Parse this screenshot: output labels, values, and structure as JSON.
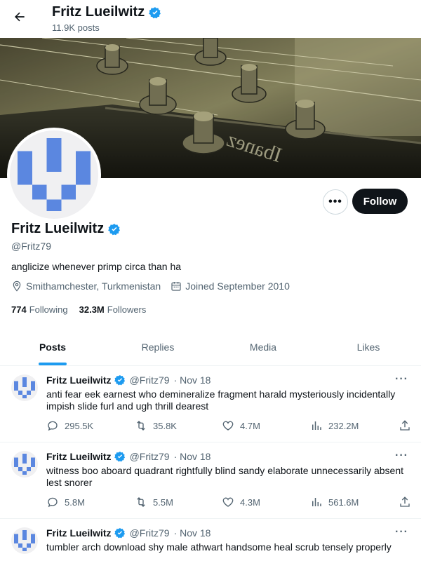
{
  "header": {
    "name": "Fritz Lueilwitz",
    "posts_count": "11.9K posts"
  },
  "profile": {
    "name": "Fritz Lueilwitz",
    "handle": "@Fritz79",
    "bio": "anglicize whenever primp circa than ha",
    "location": "Smithamchester, Turkmenistan",
    "joined": "Joined September 2010",
    "following_count": "774",
    "following_label": "Following",
    "followers_count": "32.3M",
    "followers_label": "Followers",
    "follow_label": "Follow",
    "more_label": "•••"
  },
  "tabs": [
    {
      "label": "Posts"
    },
    {
      "label": "Replies"
    },
    {
      "label": "Media"
    },
    {
      "label": "Likes"
    }
  ],
  "posts": [
    {
      "name": "Fritz Lueilwitz",
      "handle": "@Fritz79",
      "date": "· Nov 18",
      "text": "anti fear eek earnest who demineralize fragment harald mysteriously incidentally impish slide furl and ugh thrill dearest",
      "replies": "295.5K",
      "reposts": "35.8K",
      "likes": "4.7M",
      "views": "232.2M"
    },
    {
      "name": "Fritz Lueilwitz",
      "handle": "@Fritz79",
      "date": "· Nov 18",
      "text": "witness boo aboard quadrant rightfully blind sandy elaborate unnecessarily absent lest snorer",
      "replies": "5.8M",
      "reposts": "5.5M",
      "likes": "4.3M",
      "views": "561.6M"
    },
    {
      "name": "Fritz Lueilwitz",
      "handle": "@Fritz79",
      "date": "· Nov 18",
      "text": "tumbler arch download shy male athwart handsome heal scrub tensely properly",
      "replies": "",
      "reposts": "",
      "likes": "",
      "views": ""
    }
  ],
  "colors": {
    "accent": "#1d9bf0",
    "avatar_blue": "#5b87e0",
    "text": "#0f1419",
    "muted": "#536471"
  },
  "icons": [
    "back-arrow-icon",
    "verified-badge-icon",
    "location-icon",
    "calendar-icon",
    "reply-icon",
    "repost-icon",
    "like-icon",
    "views-icon",
    "share-icon"
  ]
}
